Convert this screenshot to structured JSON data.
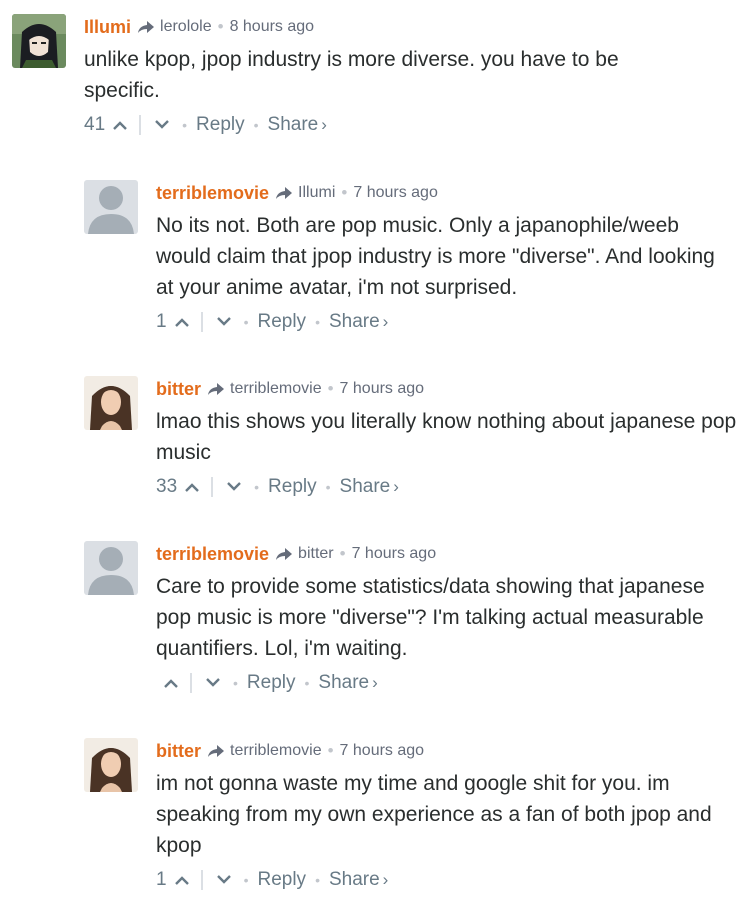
{
  "comments": [
    {
      "author": "Illumi",
      "reply_to": "lerolole",
      "time": "8 hours ago",
      "text": "unlike kpop, jpop industry is more diverse. you have to be specific.",
      "votes": "41",
      "reply_label": "Reply",
      "share_label": "Share",
      "share_arrow": "›",
      "avatar": "anime-avatar"
    },
    {
      "author": "terriblemovie",
      "reply_to": "Illumi",
      "time": "7 hours ago",
      "text": "No its not. Both are pop music. Only a japanophile/weeb would claim that jpop industry is more \"diverse\". And looking at your anime avatar, i'm not surprised.",
      "votes": "1",
      "reply_label": "Reply",
      "share_label": "Share",
      "share_arrow": "›",
      "avatar": "default-avatar"
    },
    {
      "author": "bitter",
      "reply_to": "terriblemovie",
      "time": "7 hours ago",
      "text": "lmao this shows you literally know nothing about japanese pop music",
      "votes": "33",
      "reply_label": "Reply",
      "share_label": "Share",
      "share_arrow": "›",
      "avatar": "photo-avatar"
    },
    {
      "author": "terriblemovie",
      "reply_to": "bitter",
      "time": "7 hours ago",
      "text": "Care to provide some statistics/data showing that japanese pop music is more \"diverse\"? I'm talking actual measurable quantifiers. Lol, i'm waiting.",
      "votes": "",
      "reply_label": "Reply",
      "share_label": "Share",
      "share_arrow": "›",
      "avatar": "default-avatar"
    },
    {
      "author": "bitter",
      "reply_to": "terriblemovie",
      "time": "7 hours ago",
      "text": "im not gonna waste my time and google shit for you. im speaking from my own experience as a fan of both jpop and kpop",
      "votes": "1",
      "reply_label": "Reply",
      "share_label": "Share",
      "share_arrow": "›",
      "avatar": "photo-avatar"
    }
  ],
  "colors": {
    "author": "#e36c1c",
    "meta": "#656c7a",
    "text": "#2a2e2e",
    "actions": "#687a86"
  }
}
